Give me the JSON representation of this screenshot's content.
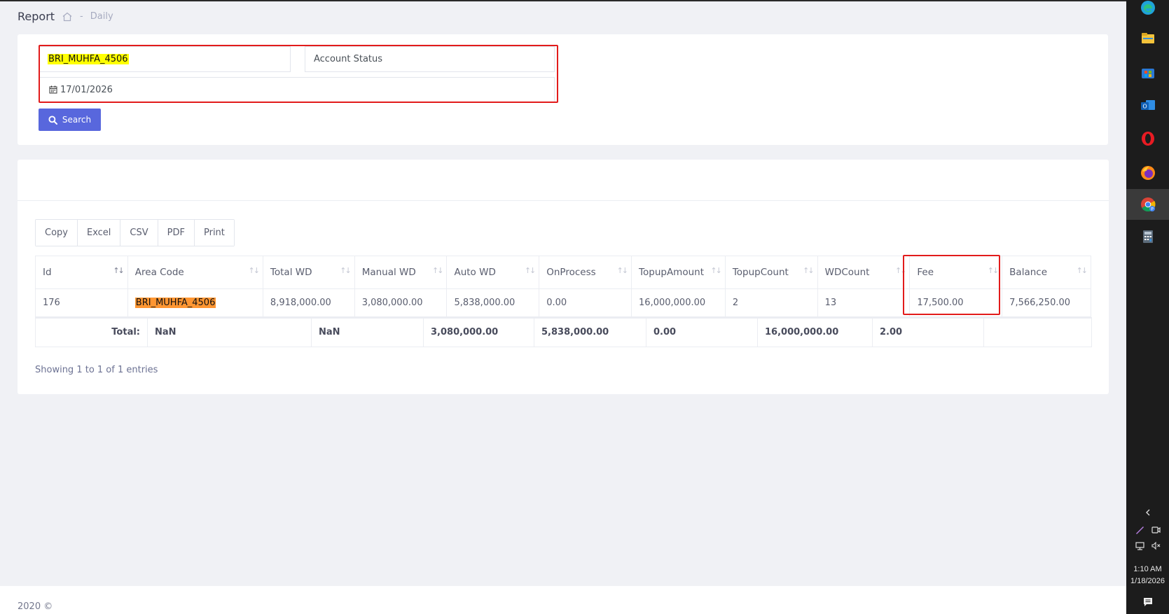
{
  "breadcrumb": {
    "title": "Report",
    "separator": "-",
    "current": "Daily"
  },
  "filters": {
    "area_code_value": "BRI_MUHFA_4506",
    "account_status_placeholder": "Account Status",
    "date_value": "17/01/2026",
    "search_label": "Search"
  },
  "exports": [
    "Copy",
    "Excel",
    "CSV",
    "PDF",
    "Print"
  ],
  "table": {
    "columns": [
      "Id",
      "Area Code",
      "Total WD",
      "Manual WD",
      "Auto WD",
      "OnProcess",
      "TopupAmount",
      "TopupCount",
      "WDCount",
      "Fee",
      "Balance"
    ],
    "rows": [
      [
        "176",
        "BRI_MUHFA_4506",
        "8,918,000.00",
        "3,080,000.00",
        "5,838,000.00",
        "0.00",
        "16,000,000.00",
        "2",
        "13",
        "17,500.00",
        "7,566,250.00"
      ]
    ],
    "totals": {
      "label": "Total:",
      "values": [
        "NaN",
        "NaN",
        "3,080,000.00",
        "5,838,000.00",
        "0.00",
        "16,000,000.00",
        "2.00",
        ""
      ]
    },
    "info": "Showing 1 to 1 of 1 entries"
  },
  "footer": {
    "text": "2020 ©"
  },
  "taskbar": {
    "apps": [
      "edge-icon",
      "file-explorer-icon",
      "store-icon",
      "outlook-icon",
      "opera-icon",
      "firefox-icon",
      "chrome-icon",
      "calculator-icon"
    ],
    "time": "1:10 AM",
    "date": "1/18/2026"
  },
  "colors": {
    "accent": "#5867dd",
    "highlight_red": "#e21b1b",
    "highlight_yellow": "#ffff00",
    "highlight_orange": "#ff9632"
  }
}
